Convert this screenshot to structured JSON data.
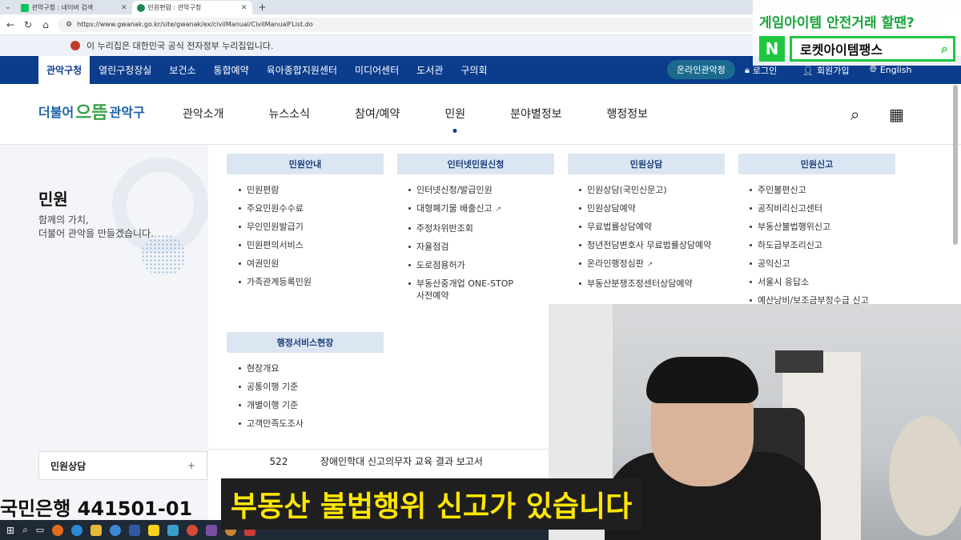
{
  "browser": {
    "tabs": [
      {
        "label": "관악구청 : 네이버 검색",
        "active": false,
        "favicon_color": "#03c75a"
      },
      {
        "label": "민원편람 : 관악구청",
        "active": true,
        "favicon_color": "#1e8a5a"
      }
    ],
    "new_tab": "+",
    "url": "https://www.gwanak.go.kr/site/gwanak/ex/civilManual/CivilManualFList.do"
  },
  "gov_banner": {
    "text": "이 누리집은 대한민국 공식 전자정부 누리집입니다."
  },
  "top_nav": {
    "items": [
      "관악구청",
      "열린구청장실",
      "보건소",
      "통합예약",
      "육아종합지원센터",
      "미디어센터",
      "도서관",
      "구의회"
    ],
    "online_button": "온라인관악청",
    "login": "로그인",
    "signup": "회원가입",
    "english": "English"
  },
  "header": {
    "logo": {
      "left": "더불어",
      "middle": "으뜸",
      "right": "관악구"
    },
    "menu": [
      "관악소개",
      "뉴스소식",
      "참여/예약",
      "민원",
      "분야별정보",
      "행정정보"
    ],
    "selected_menu": "민원"
  },
  "sidebar": {
    "title": "민원",
    "subtitle_line1": "함께의 가치,",
    "subtitle_line2": "더불어 관악을 만들겠습니다.",
    "accordion_label": "민원상담",
    "accordion_icon": "+"
  },
  "mega_menu": {
    "columns": [
      {
        "heading": "민원안내",
        "items": [
          "민원편람",
          "주요민원수수료",
          "무인민원발급기",
          "민원편의서비스",
          "여권민원",
          "가족관계등록민원"
        ]
      },
      {
        "heading": "인터넷민원신청",
        "items": [
          "인터넷신청/발급민원",
          "대형폐기물 배출신고",
          "주정차위반조회",
          "자율점검",
          "도로점용허가",
          "부동산중개업 ONE-STOP 사전예약"
        ]
      },
      {
        "heading": "민원상담",
        "items": [
          "민원상담(국민신문고)",
          "민원상담예약",
          "무료법률상담예약",
          "청년전담변호사 무료법률상담예약",
          "온라인행정심판",
          "부동산분쟁조정센터상담예약"
        ]
      },
      {
        "heading": "민원신고",
        "items": [
          "주민불편신고",
          "공직비리신고센터",
          "부동산불법행위신고",
          "하도급부조리신고",
          "공익신고",
          "서울시 응답소",
          "예산낭비/보조금부정수급 신고"
        ]
      }
    ],
    "second_group": {
      "heading": "행정서비스현장",
      "items": [
        "현장개요",
        "공통이행 기준",
        "개별이행 기준",
        "고객만족도조사"
      ]
    }
  },
  "list_row": {
    "number": "522",
    "title": "장애인학대 신고의무자 교육 결과 보고서"
  },
  "overlay": {
    "promo_title": "게임아이템 안전거래 할땐?",
    "promo_badge": "N",
    "promo_search": "로켓아이템팽스",
    "account_text": "국민은행 441501-01",
    "subtitle": "부동산 불법행위 신고가 있습니다"
  },
  "colors": {
    "nav_blue": "#0c3c8c",
    "menu_head_bg": "#dce6f3",
    "promo_green": "#1ec73f",
    "subtitle_yellow": "#ffe600"
  }
}
